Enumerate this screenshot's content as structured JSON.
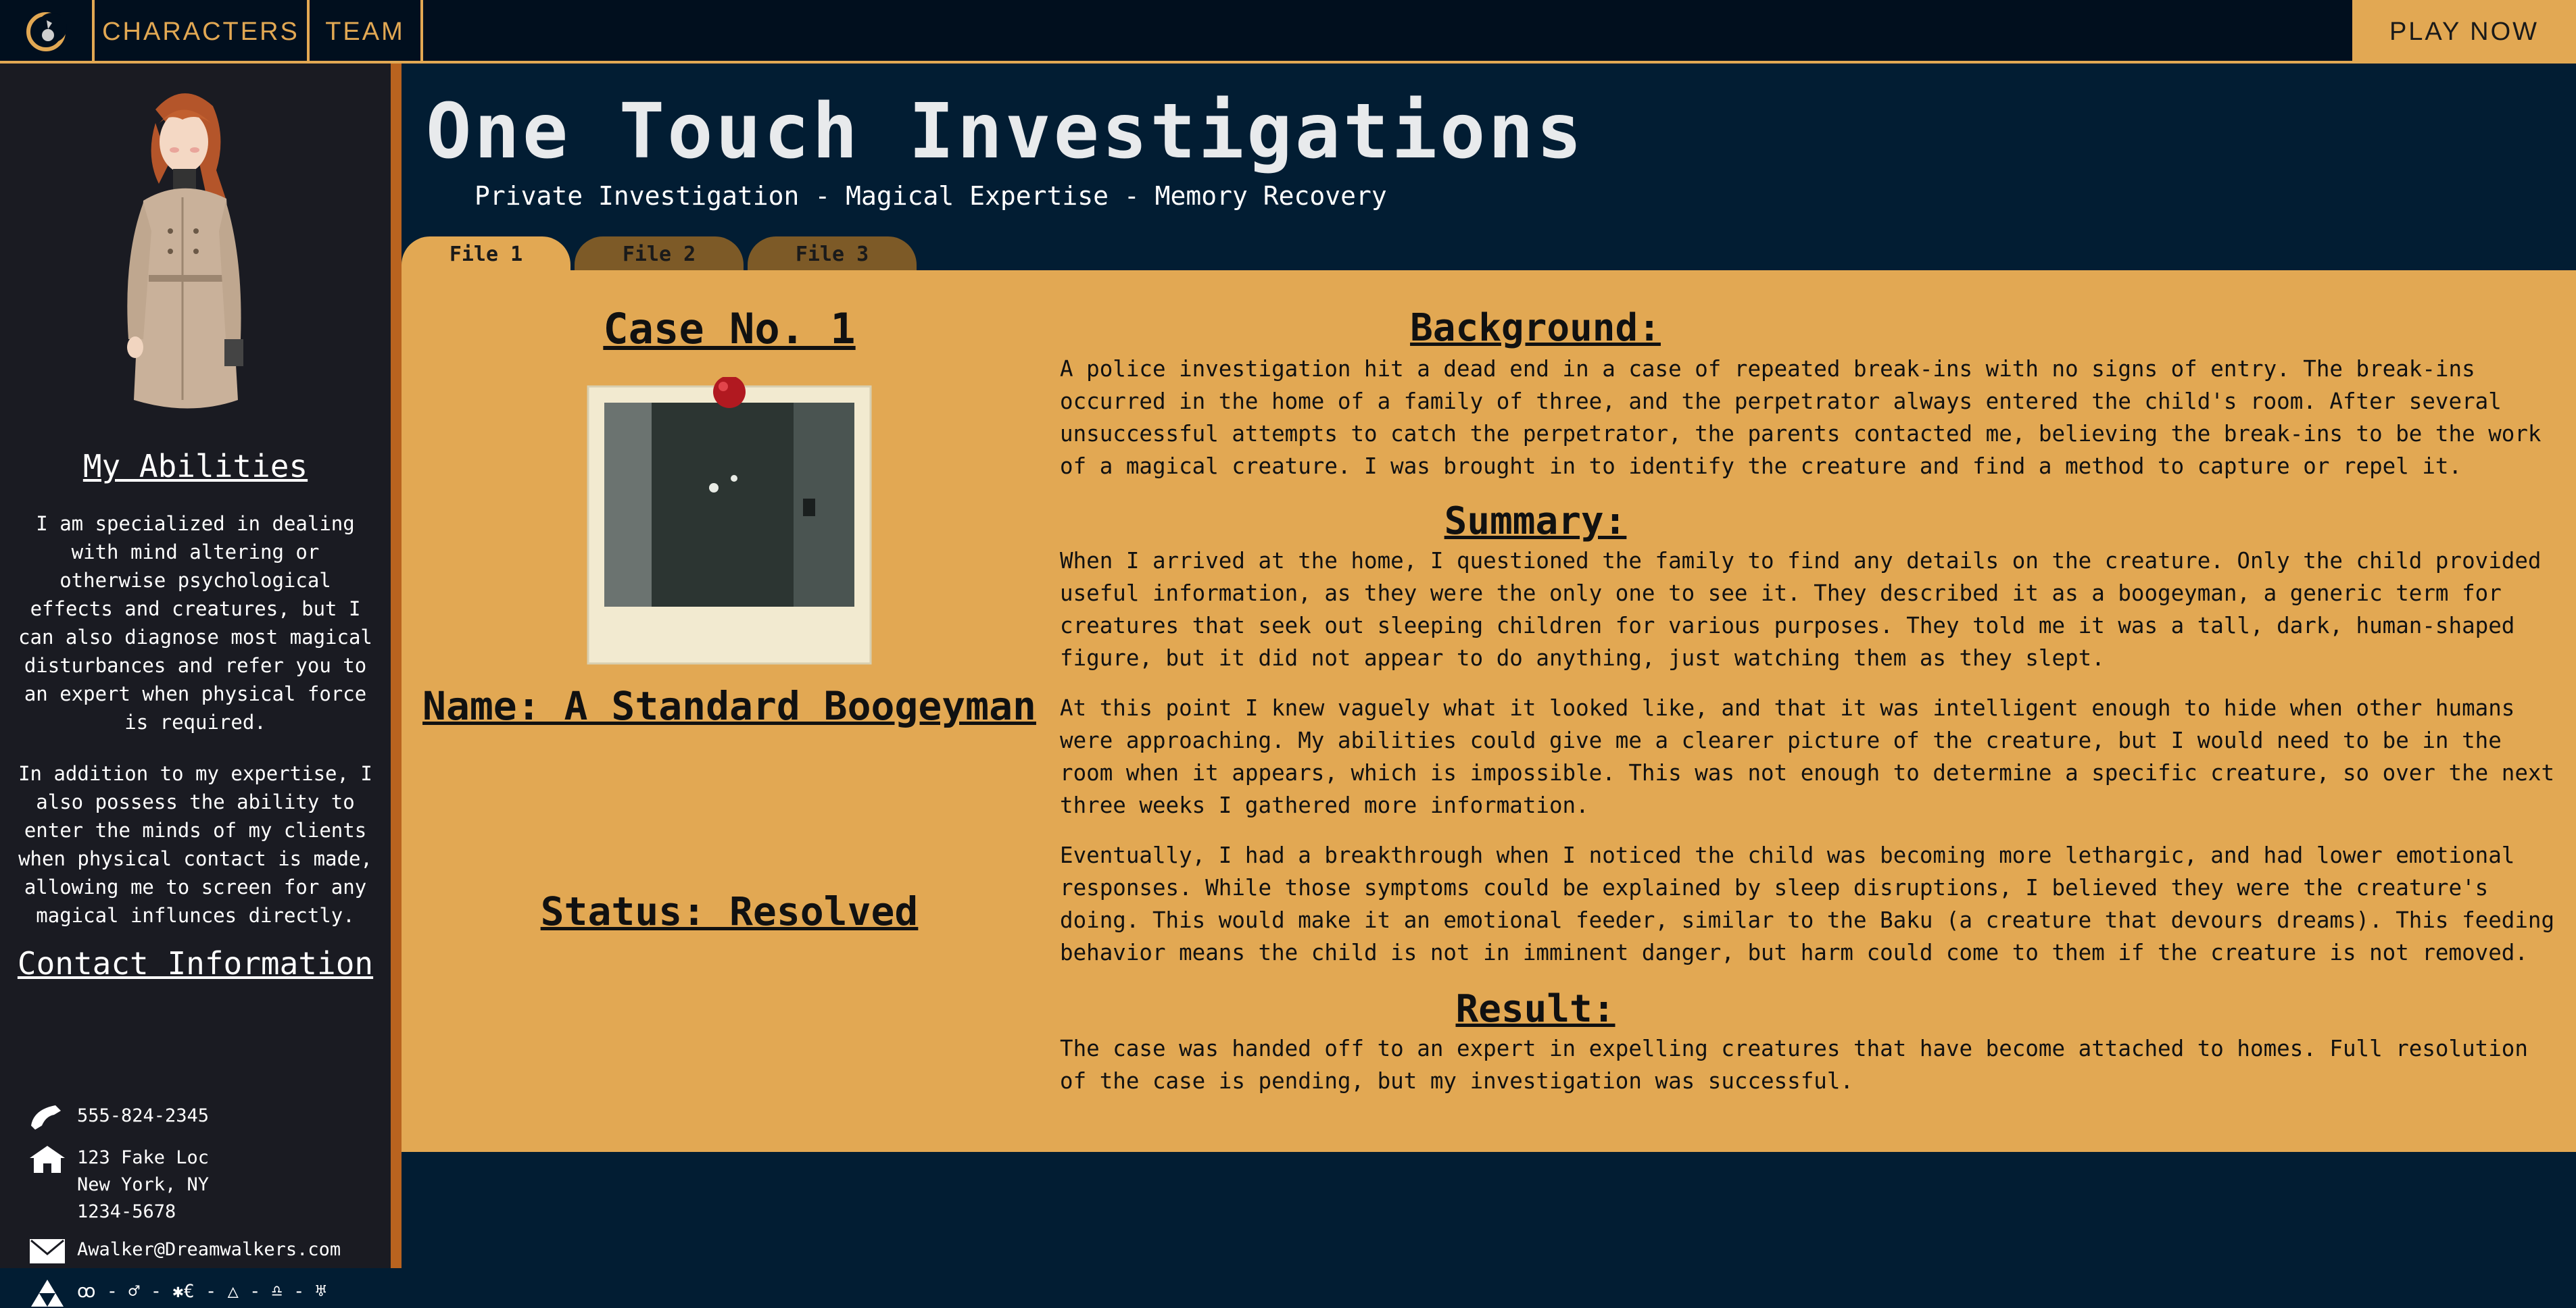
{
  "nav": {
    "logo_icon": "crescent-moon-logo-icon",
    "characters_label": "CHARACTERS",
    "team_label": "TEAM",
    "play_now_label": "PLAY NOW"
  },
  "sidebar": {
    "abilities_title": "My Abilities",
    "abilities_p1": "I am specialized in dealing with mind altering or otherwise psychological effects and creatures, but I can also diagnose most magical disturbances and refer you to an expert when physical force is required.",
    "abilities_p2": "In addition to my expertise, I also possess the ability to enter the minds of my clients when physical contact is made, allowing me to screen for any magical influnces directly.",
    "contact_title": "Contact Information",
    "phone": "555-824-2345",
    "address_line1": "123 Fake Loc",
    "address_line2": "New York, NY",
    "address_line3": "1234-5678",
    "email": "Awalker@Dreamwalkers.com",
    "symbol_line": "ꝏ - ♂ - ✱€ - △ - ♎ - ♅"
  },
  "header": {
    "title": "One Touch Investigations",
    "subtitle": "Private Investigation - Magical Expertise - Memory Recovery"
  },
  "tabs": [
    {
      "label": "File 1",
      "active": true
    },
    {
      "label": "File 2",
      "active": false
    },
    {
      "label": "File 3",
      "active": false
    }
  ],
  "case": {
    "number": "Case No. 1",
    "name": "Name: A Standard Boogeyman",
    "status": "Status: Resolved"
  },
  "sections": {
    "background_title": "Background:",
    "background_text": "A police investigation hit a dead end in a case of repeated break-ins with no signs of entry. The break-ins occurred in the home of a family of three, and the perpetrator always entered the child's room. After several unsuccessful attempts to catch the perpetrator, the parents contacted me, believing the break-ins to be the work of a magical creature. I was brought in to identify the creature and find a method to capture or repel it.",
    "summary_title": "Summary:",
    "summary_p1": "When I arrived at the home, I questioned the family to find any details on the creature. Only the child provided useful information, as they were the only one to see it. They described it as a boogeyman, a generic term for creatures that seek out sleeping children for various purposes. They told me it was a tall, dark, human-shaped figure, but it did not appear to do anything, just watching them as they slept.",
    "summary_p2": "At this point I knew vaguely what it looked like, and that it was intelligent enough to hide when other humans were approaching. My abilities could give me a clearer picture of the creature, but I would need to be in the room when it appears, which is impossible. This was not enough to determine a specific creature, so over the next three weeks I gathered more information.",
    "summary_p3": "Eventually, I had a breakthrough when I noticed the child was becoming more lethargic, and had lower emotional responses. While those symptoms could be explained by sleep disruptions, I believed they were the creature's doing. This would make it an emotional feeder, similar to the Baku (a creature that devours dreams). This feeding behavior means the child is not in imminent danger, but harm could come to them if the creature is not removed.",
    "result_title": "Result:",
    "result_text": "The case was handed off to an expert in expelling creatures that have become attached to homes. Full resolution of the case is pending, but my investigation was successful."
  },
  "colors": {
    "accent": "#e2a853",
    "nav_bg": "#010f1e",
    "page_bg": "#021d33",
    "sidebar_bg": "#1a1b22",
    "sidebar_edge": "#b9631f",
    "inactive_tab": "#7d5a27"
  }
}
